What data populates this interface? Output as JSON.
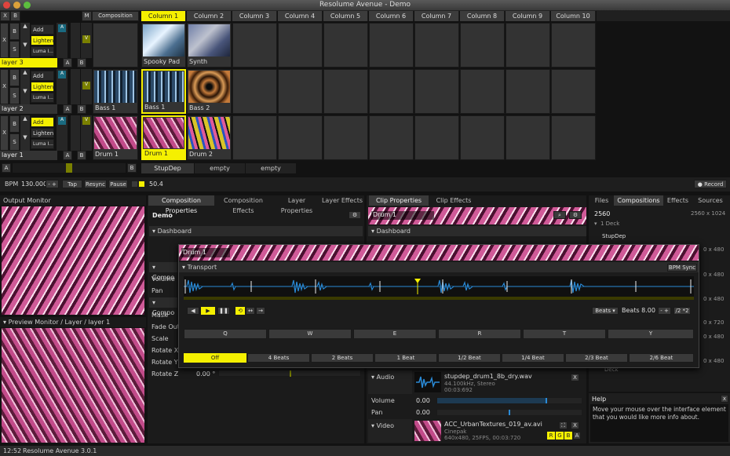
{
  "window": {
    "title": "Resolume Avenue - Demo"
  },
  "deck": {
    "x_label": "X",
    "b_label": "B",
    "m_label": "M",
    "composition_label": "Composition",
    "columns": [
      "Column 1",
      "Column 2",
      "Column 3",
      "Column 4",
      "Column 5",
      "Column 6",
      "Column 7",
      "Column 8",
      "Column 9",
      "Column 10"
    ]
  },
  "layers": [
    {
      "name": "layer 3",
      "blend": [
        "Add",
        "Lighten",
        "Luma I..."
      ],
      "active_blend": 1,
      "clips": [
        {
          "name": "Spooky Pad",
          "thumb": "blueA"
        },
        {
          "name": "Synth",
          "thumb": "blueA"
        }
      ]
    },
    {
      "name": "layer 2",
      "blend": [
        "Add",
        "Lighten",
        "Luma I..."
      ],
      "active_blend": 1,
      "comp_clip": "Bass 1",
      "clips": [
        {
          "name": "Bass 1",
          "thumb": "blueB"
        },
        {
          "name": "Bass 2",
          "thumb": "tunnel"
        }
      ]
    },
    {
      "name": "layer 1",
      "blend": [
        "Add",
        "Lighten",
        "Luma I..."
      ],
      "active_blend": 0,
      "comp_clip": "Drum 1",
      "clips": [
        {
          "name": "Drum 1",
          "thumb": "pink"
        },
        {
          "name": "Drum 2",
          "thumb": "colorful"
        }
      ]
    }
  ],
  "layer_buttons": {
    "x": "X",
    "b": "B",
    "s": "S",
    "a": "A"
  },
  "crossfader": {
    "a": "A",
    "b": "B"
  },
  "deck_tabs": [
    "StupDep",
    "empty",
    "empty"
  ],
  "bpm": {
    "label": "BPM",
    "value": "130.000",
    "minus_plus": "- +",
    "tap": "Tap",
    "resync": "Resync",
    "pause": "Pause",
    "beat": "50.4",
    "record": "Record"
  },
  "output_monitor": {
    "title": "Output Monitor"
  },
  "preview_monitor": {
    "title": "Preview Monitor / Layer / layer 1"
  },
  "comp_tabs": [
    "Composition Properties",
    "Composition Effects",
    "Layer Properties",
    "Layer Effects"
  ],
  "comp_panel": {
    "name": "Demo",
    "dashboard": "Dashboard",
    "comp_section_1": "Compo",
    "volume": "Volume",
    "pan": "Pan",
    "comp_section_2": "Compo",
    "mask": "Mask",
    "fade_out": "Fade Out",
    "scale": "Scale",
    "rotate_x": "Rotate X",
    "rotate_y": "Rotate Y",
    "rotate_z": "Rotate Z",
    "rotate_z_value": "0.00 °"
  },
  "clip_tabs": [
    "Clip Properties",
    "Clip Effects"
  ],
  "clip_panel": {
    "name": "Drum 1",
    "dashboard": "Dashboard",
    "audio_label": "Audio",
    "audio_file": "stupdep_drum1_8b_dry.wav",
    "audio_info1": "44.100kHz, Stereo",
    "audio_info2": "00:03:692",
    "volume": "Volume",
    "volume_value": "0.00",
    "pan": "Pan",
    "pan_value": "0.00",
    "video_label": "Video",
    "video_file": "ACC_UrbanTextures_019_av.avi",
    "video_codec": "Cinepak",
    "video_info": "640x480, 25FPS, 00:03:720",
    "rgba": [
      "R",
      "G",
      "B",
      "A"
    ],
    "x": "X"
  },
  "popup": {
    "name": "Drum 1",
    "transport": "Transport",
    "bpm_sync": "BPM Sync",
    "beats_label": "Beats",
    "beats_value": "Beats 8.00",
    "minus_plus": "- +",
    "half_double": "/2 *2",
    "cue_keys": [
      "Q",
      "W",
      "E",
      "R",
      "T",
      "Y"
    ],
    "beat_options": [
      "Off",
      "4 Beats",
      "2 Beats",
      "1 Beat",
      "1/2 Beat",
      "1/4 Beat",
      "2/3 Beat",
      "2/6 Beat"
    ]
  },
  "browser_tabs": [
    "Files",
    "Compositions",
    "Effects",
    "Sources"
  ],
  "browser": {
    "comp_name": "2560",
    "comp_res": "2560 x 1024",
    "deck": "1 Deck",
    "deck_item": "StupDep",
    "res_list": [
      "0 x 480",
      "0 x 480",
      "0 x 480",
      "0 x 720",
      "0 x 480",
      "0 x 480"
    ],
    "deck_label2": "Deck"
  },
  "help": {
    "title": "Help",
    "text1": "Move your mouse over the interface element",
    "text2": "that you would like more info about."
  },
  "status": {
    "time": "12:52",
    "app": "Resolume Avenue 3.0.1"
  },
  "colors": {
    "accent": "#f5f000",
    "waveform": "#2a8ad6",
    "teal": "#1a6a80"
  }
}
